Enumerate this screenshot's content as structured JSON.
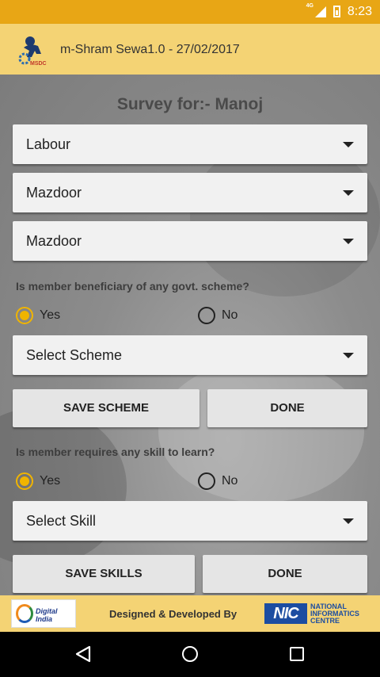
{
  "status_bar": {
    "time": "8:23",
    "network": "4G"
  },
  "app_bar": {
    "title": "m-Shram Sewa1.0 - 27/02/2017",
    "logo_icon": "mssdc-logo-icon",
    "logo_text": "MSDC"
  },
  "survey": {
    "title": "Survey for:- Manoj",
    "spinners": [
      "Labour",
      "Mazdoor",
      "Mazdoor"
    ],
    "scheme_question": "Is member beneficiary of any govt. scheme?",
    "scheme_yes": "Yes",
    "scheme_no": "No",
    "scheme_selected": "Yes",
    "scheme_spinner": "Select Scheme",
    "save_scheme_label": "SAVE SCHEME",
    "done_label": "DONE",
    "skill_question": "Is member requires any skill to learn?",
    "skill_yes": "Yes",
    "skill_no": "No",
    "skill_selected": "Yes",
    "skill_spinner": "Select Skill",
    "save_skills_label": "SAVE SKILLS",
    "done2_label": "DONE"
  },
  "footer": {
    "digital_india": "Digital India",
    "designed_by": "Designed & Developed By",
    "nic_mark": "NIC",
    "nic_line1": "NATIONAL",
    "nic_line2": "INFORMATICS",
    "nic_line3": "CENTRE"
  },
  "colors": {
    "accent": "#F0B400",
    "app_bar": "#F4D374",
    "status_bar": "#E8A615"
  }
}
